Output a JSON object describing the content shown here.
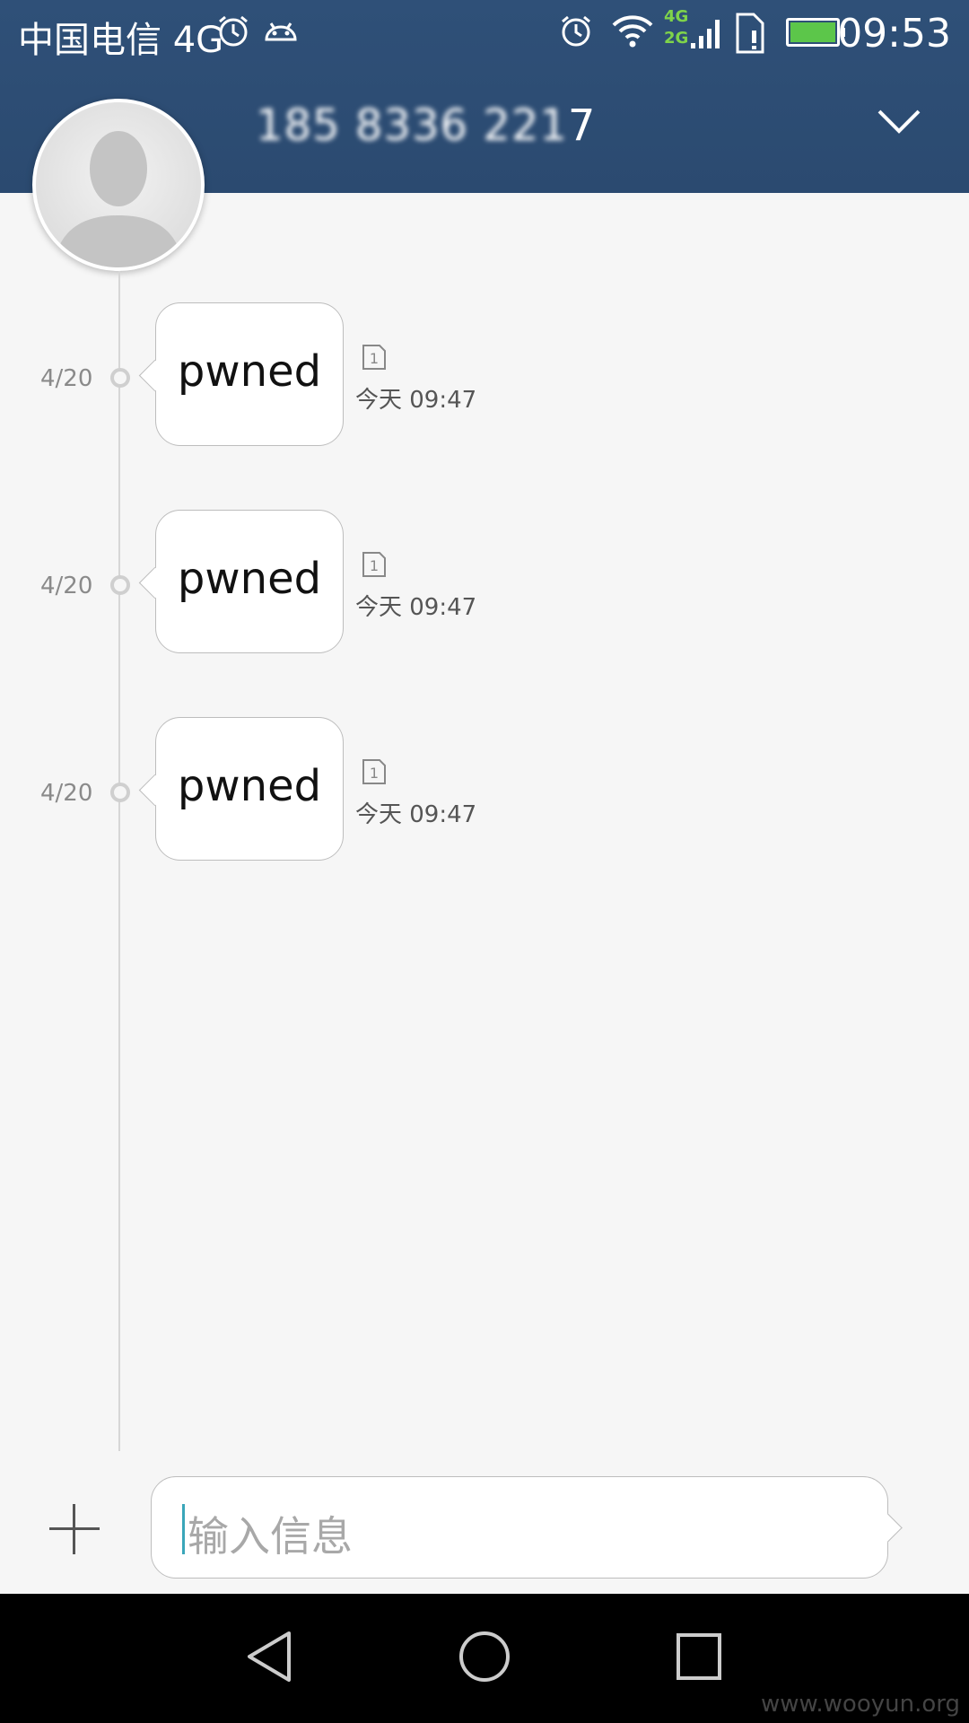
{
  "status_bar": {
    "carrier": "中国电信 4G",
    "network_upper": "4G",
    "network_lower": "2G",
    "time": "09:53",
    "icons": [
      "alarm-icon",
      "android-debug-icon",
      "alarm-icon",
      "wifi-icon",
      "signal-icon",
      "sim-icon",
      "battery-charging-icon"
    ]
  },
  "header": {
    "contact_number_blurred": "185 8336 221",
    "contact_number_last": "7",
    "expand_icon": "chevron-down-icon"
  },
  "messages": [
    {
      "date": "4/20",
      "text": "pwned",
      "time": "今天 09:47",
      "sim_label": "1"
    },
    {
      "date": "4/20",
      "text": "pwned",
      "time": "今天 09:47",
      "sim_label": "1"
    },
    {
      "date": "4/20",
      "text": "pwned",
      "time": "今天 09:47",
      "sim_label": "1"
    }
  ],
  "composer": {
    "placeholder": "输入信息"
  },
  "nav": {
    "buttons": [
      "back-icon",
      "home-icon",
      "recents-icon"
    ]
  },
  "watermark": "www.wooyun.org",
  "colors": {
    "header_bg": "#2d4d74",
    "battery_fill": "#5cc64a",
    "network_label": "#7fd44a",
    "caret": "#3aa6b9"
  }
}
